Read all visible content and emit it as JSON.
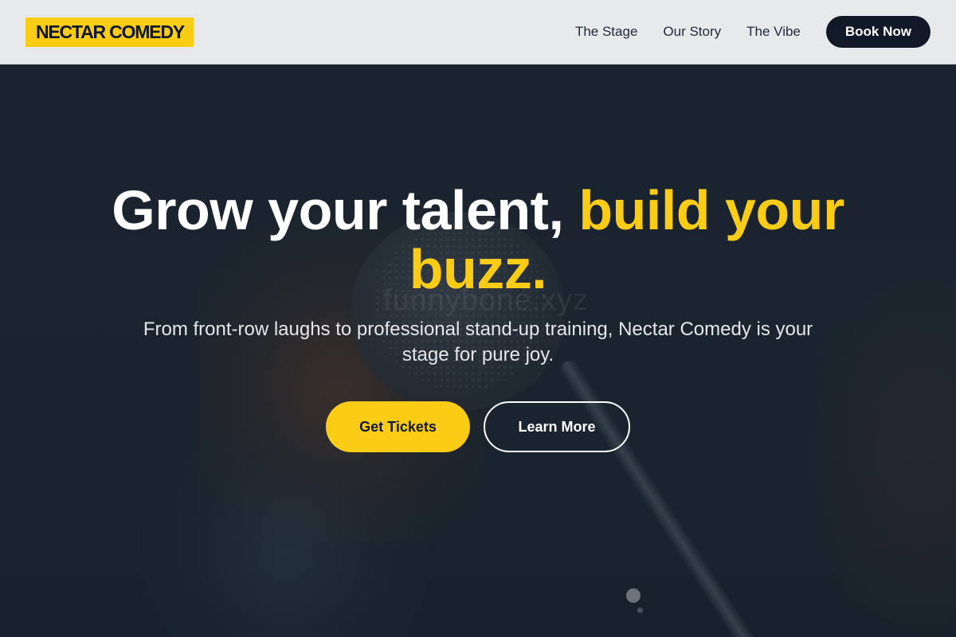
{
  "header": {
    "logo": "NECTAR COMEDY",
    "nav": [
      {
        "label": "The Stage"
      },
      {
        "label": "Our Story"
      },
      {
        "label": "The Vibe"
      }
    ],
    "cta_label": "Book Now"
  },
  "hero": {
    "headline_white": "Grow your talent,",
    "headline_accent": "build your buzz.",
    "subtitle": "From front-row laughs to professional stand-up training, Nectar Comedy is your stage for pure joy.",
    "primary_button": "Get Tickets",
    "secondary_button": "Learn More",
    "watermark": "funnybone.xyz"
  },
  "colors": {
    "accent": "#facc15",
    "dark": "#111827",
    "header_bg": "#e8e9eb"
  }
}
